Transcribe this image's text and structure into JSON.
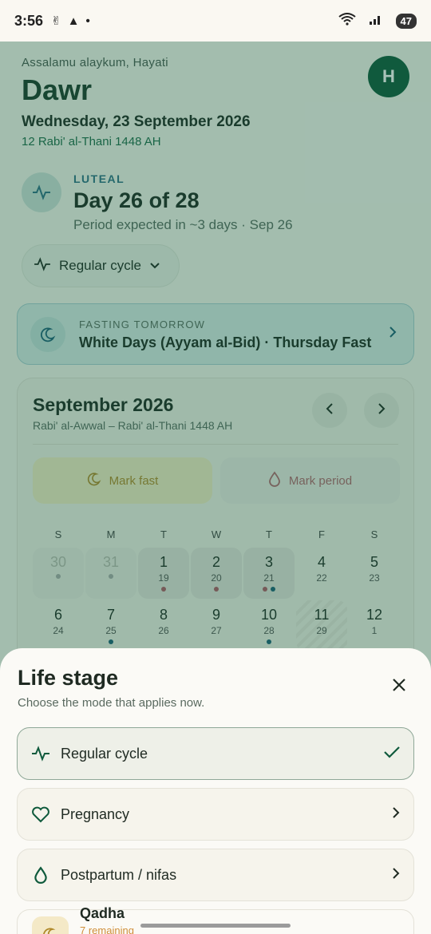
{
  "status_bar": {
    "time": "3:56",
    "battery": "47"
  },
  "header": {
    "greeting": "Assalamu alaykum, Hayati",
    "app_title": "Dawr",
    "avatar_initial": "H",
    "gregorian_date": "Wednesday, 23 September 2026",
    "hijri_date": "12 Rabi' al-Thani 1448 AH"
  },
  "phase": {
    "label": "LUTEAL",
    "day_text": "Day 26 of 28",
    "sub": "Period expected in ~3 days · Sep 26"
  },
  "cycle_selector": {
    "label": "Regular cycle"
  },
  "fasting_banner": {
    "label": "FASTING TOMORROW",
    "value": "White Days (Ayyam al-Bid) · Thursday Fast"
  },
  "calendar": {
    "title": "September 2026",
    "hijri_range": "Rabi' al-Awwal – Rabi' al-Thani 1448 AH",
    "mark_fast_label": "Mark fast",
    "mark_period_label": "Mark period",
    "weekdays": [
      "S",
      "M",
      "T",
      "W",
      "T",
      "F",
      "S"
    ],
    "rows": [
      [
        {
          "n": "30",
          "h": "",
          "muted": true,
          "dots": [
            "gray"
          ]
        },
        {
          "n": "31",
          "h": "",
          "muted": true,
          "dots": [
            "gray"
          ]
        },
        {
          "n": "1",
          "h": "19",
          "period": true,
          "dots": [
            "rose"
          ]
        },
        {
          "n": "2",
          "h": "20",
          "period": true,
          "dots": [
            "rose"
          ]
        },
        {
          "n": "3",
          "h": "21",
          "period": true,
          "dots": [
            "rose",
            "teal"
          ]
        },
        {
          "n": "4",
          "h": "22",
          "dots": []
        },
        {
          "n": "5",
          "h": "23",
          "dots": []
        }
      ],
      [
        {
          "n": "6",
          "h": "24",
          "dots": []
        },
        {
          "n": "7",
          "h": "25",
          "dots": [
            "teal"
          ]
        },
        {
          "n": "8",
          "h": "26",
          "dots": []
        },
        {
          "n": "9",
          "h": "27",
          "dots": []
        },
        {
          "n": "10",
          "h": "28",
          "dots": [
            "teal"
          ]
        },
        {
          "n": "11",
          "h": "29",
          "hatch": true,
          "dots": []
        },
        {
          "n": "12",
          "h": "1",
          "dots": []
        }
      ]
    ]
  },
  "sheet": {
    "title": "Life stage",
    "subtitle": "Choose the mode that applies now.",
    "options": [
      {
        "label": "Regular cycle",
        "selected": true
      },
      {
        "label": "Pregnancy",
        "selected": false
      },
      {
        "label": "Postpartum / nifas",
        "selected": false
      }
    ],
    "peek": {
      "title": "Qadha",
      "sub": "7 remaining"
    }
  },
  "colors": {
    "accent": "#0f5a3c",
    "scrim": "#125c42",
    "period_dot": "#b05a66",
    "fast_dot": "#1e5f78",
    "muted_dot": "#aaaaaa"
  }
}
